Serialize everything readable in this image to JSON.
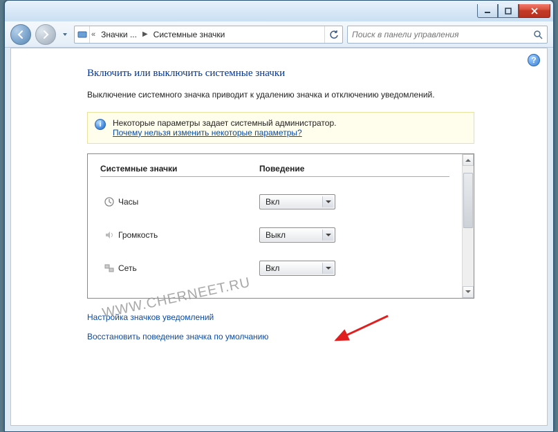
{
  "breadcrumb": {
    "level1": "Значки ...",
    "level2": "Системные значки"
  },
  "search": {
    "placeholder": "Поиск в панели управления"
  },
  "page": {
    "title": "Включить или выключить системные значки",
    "description": "Выключение системного значка приводит к удалению значка и отключению уведомлений."
  },
  "infobar": {
    "text": "Некоторые параметры задает системный администратор.",
    "link_text": "Почему нельзя изменить некоторые параметры?"
  },
  "table": {
    "col1": "Системные значки",
    "col2": "Поведение",
    "rows": [
      {
        "label": "Часы",
        "value": "Вкл"
      },
      {
        "label": "Громкость",
        "value": "Выкл"
      },
      {
        "label": "Сеть",
        "value": "Вкл"
      }
    ]
  },
  "links": {
    "customize": "Настройка значков уведомлений",
    "restore": "Восстановить поведение значка по умолчанию"
  },
  "watermark": "WWW.CHERNEET.RU"
}
